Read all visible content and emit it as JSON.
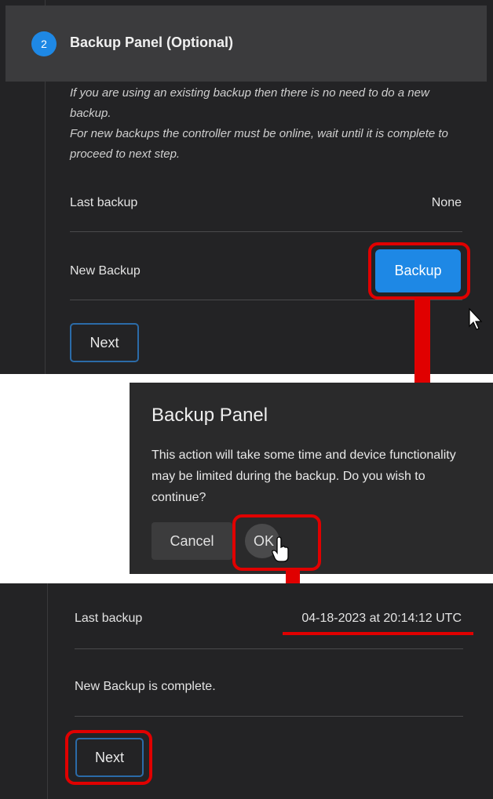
{
  "step_panel": {
    "step_number": "2",
    "title": "Backup Panel (Optional)",
    "description_line1": "If you are using an existing backup then there is no need to do a new backup.",
    "description_line2": "For new backups the controller must be online, wait until it is complete to proceed to next step.",
    "last_backup_label": "Last backup",
    "last_backup_value": "None",
    "new_backup_label": "New Backup",
    "backup_button": "Backup",
    "next_button": "Next"
  },
  "dialog": {
    "title": "Backup Panel",
    "message": "This action will take some time and device functionality may be limited during the backup. Do you wish to continue?",
    "cancel_button": "Cancel",
    "ok_button": "OK"
  },
  "result_panel": {
    "last_backup_label": "Last backup",
    "last_backup_value": "04-18-2023 at 20:14:12 UTC",
    "status_message": "New Backup is complete.",
    "next_button": "Next"
  },
  "colors": {
    "panel_background": "#232325",
    "header_background": "#3b3b3d",
    "accent_blue": "#1e88e5",
    "highlight_red": "#e00000"
  },
  "icons": [
    "step-number-circle",
    "mouse-pointer-icon",
    "hand-cursor-icon",
    "down-arrow-icon"
  ]
}
